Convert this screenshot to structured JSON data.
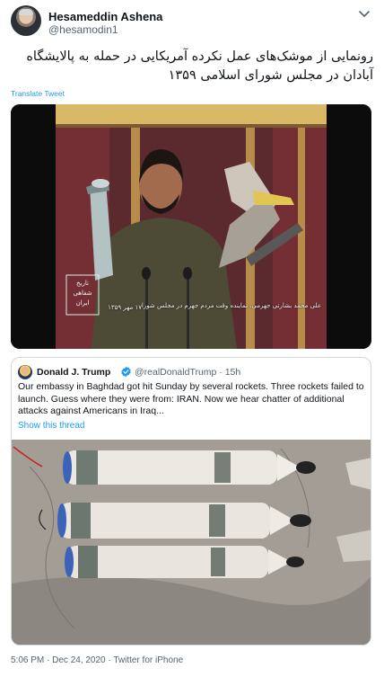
{
  "author": {
    "name": "Hesameddin Ashena",
    "handle": "@hesamodin1"
  },
  "tweet": {
    "text": "رونمایی از موشک‌های عمل نکرده آمریکایی در حمله به پالایشگاه آبادان در مجلس شورای اسلامی ۱۳۵۹",
    "translate_label": "Translate Tweet"
  },
  "video": {
    "caption": "علی محمد بشارتی جهرمی، نماینده وقت مردم جهرم در مجلس شورای اسلامی",
    "date_overlay": "۱۷ مهر ۱۳۵۹",
    "logo_text": "تاریخ شفاهی ایران"
  },
  "quoted": {
    "name": "Donald J. Trump",
    "handle_time": "@realDonaldTrump · 15h",
    "text": "Our embassy in Baghdad got hit Sunday by several rockets. Three rockets failed to launch. Guess where they were from: IRAN. Now we hear chatter of additional attacks against Americans in Iraq...",
    "show_thread": "Show this thread"
  },
  "footer": {
    "meta": "5:06 PM · Dec 24, 2020 · Twitter for iPhone"
  },
  "colors": {
    "accent": "#1d9bf0",
    "text": "#0f1419",
    "muted": "#536471",
    "border": "#cfd9de"
  }
}
